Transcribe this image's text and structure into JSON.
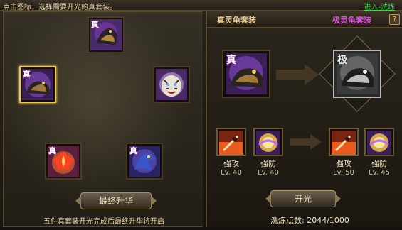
{
  "topbar": {
    "hint": "点击图标，选择需要开光的真套装。",
    "link": "进入-洗炼"
  },
  "left": {
    "slots": [
      {
        "tag": "真",
        "creature": "dark-beast-icon"
      },
      {
        "tag": "真",
        "creature": "turtle-beast-icon"
      },
      {
        "tag": "",
        "creature": "tiger-icon"
      },
      {
        "tag": "真",
        "creature": "phoenix-icon"
      },
      {
        "tag": "真",
        "creature": "dragon-icon"
      }
    ],
    "upgrade_button": "最终升华",
    "footnote": "五件真套装开光完成后最终升华将开启"
  },
  "right": {
    "header_left": "真灵龟套装",
    "header_right": "极灵龟套装",
    "help": "?",
    "big_left_tag": "真",
    "big_right_tag": "极",
    "skills_left": [
      {
        "label": "强攻",
        "level": "Lv. 40",
        "icon": "sword-attack-icon"
      },
      {
        "label": "强防",
        "level": "Lv. 40",
        "icon": "shield-orb-icon"
      }
    ],
    "skills_right": [
      {
        "label": "强攻",
        "level": "Lv. 50",
        "icon": "sword-attack-icon"
      },
      {
        "label": "强防",
        "level": "Lv. 45",
        "icon": "shield-orb-icon"
      }
    ],
    "open_button": "开光",
    "score": "洗炼点数: 2044/1000"
  },
  "colors": {
    "accent_gold": "#f0c84a",
    "link_green": "#38d84d",
    "header_purple": "#d55ad6"
  }
}
